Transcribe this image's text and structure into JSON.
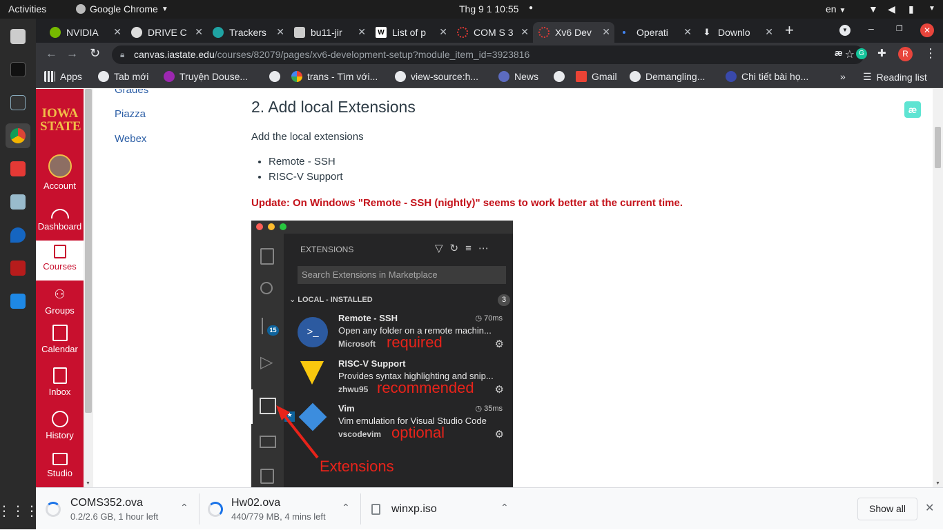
{
  "topbar": {
    "activities": "Activities",
    "app": "Google Chrome",
    "clock": "Thg 9 1  10:55",
    "lang": "en"
  },
  "tabs": [
    {
      "title": "NVIDIA",
      "fav_color": "#76b900"
    },
    {
      "title": "DRIVE C",
      "fav_color": "#dddddd"
    },
    {
      "title": "Trackers",
      "fav_color": "#1fa3a3"
    },
    {
      "title": "bu11-jir",
      "fav_color": "#cccccc"
    },
    {
      "title": "List of p",
      "fav_color": "#ffffff"
    },
    {
      "title": "COM S 3",
      "fav_color": "#e53935"
    },
    {
      "title": "Xv6 Dev",
      "fav_color": "#e53935"
    },
    {
      "title": "Operati",
      "fav_color": "#4285f4"
    },
    {
      "title": "Downlo",
      "fav_color": "#e8eaed"
    }
  ],
  "address": {
    "host": "canvas.iastate.edu",
    "path": "/courses/82079/pages/xv6-development-setup?module_item_id=3923816",
    "avatar_letter": "R"
  },
  "bookmarks": [
    {
      "label": "Apps"
    },
    {
      "label": "Tab mới"
    },
    {
      "label": "Truyện Douse..."
    },
    {
      "label": ""
    },
    {
      "label": "trans - Tìm với..."
    },
    {
      "label": "view-source:h..."
    },
    {
      "label": "News"
    },
    {
      "label": ""
    },
    {
      "label": "Gmail"
    },
    {
      "label": "Demangling..."
    },
    {
      "label": "Chi tiết bài họ..."
    },
    {
      "label": "»"
    },
    {
      "label": "Reading list"
    }
  ],
  "canvas_nav": {
    "logo_line1": "IOWA",
    "logo_line2": "STATE",
    "items": [
      {
        "label": "Account"
      },
      {
        "label": "Dashboard"
      },
      {
        "label": "Courses"
      },
      {
        "label": "Groups"
      },
      {
        "label": "Calendar"
      },
      {
        "label": "Inbox"
      },
      {
        "label": "History"
      },
      {
        "label": "Studio"
      }
    ]
  },
  "course_nav": {
    "items": [
      {
        "label": "Grades"
      },
      {
        "label": "Piazza"
      },
      {
        "label": "Webex"
      }
    ]
  },
  "content": {
    "heading": "2. Add local Extensions",
    "intro": "Add the local extensions",
    "bullets": [
      "Remote - SSH",
      "RISC-V Support"
    ],
    "update": "Update: On Windows \"Remote - SSH (nightly)\" seems to work better at the current time."
  },
  "vscode": {
    "panel_title": "EXTENSIONS",
    "search_placeholder": "Search Extensions in Marketplace",
    "section": "LOCAL - INSTALLED",
    "section_count": "3",
    "scm_badge": "15",
    "extensions": [
      {
        "name": "Remote - SSH",
        "time": "70ms",
        "desc": "Open any folder on a remote machin...",
        "publisher": "Microsoft",
        "note": "required"
      },
      {
        "name": "RISC-V Support",
        "time": "",
        "desc": "Provides syntax highlighting and snip...",
        "publisher": "zhwu95",
        "note": "recommended"
      },
      {
        "name": "Vim",
        "time": "35ms",
        "desc": "Vim emulation for Visual Studio Code",
        "publisher": "vscodevim",
        "note": "optional"
      }
    ],
    "arrow_label": "Extensions"
  },
  "downloads": {
    "items": [
      {
        "name": "COMS352.ova",
        "status": "0.2/2.6 GB, 1 hour left"
      },
      {
        "name": "Hw02.ova",
        "status": "440/779 MB, 4 mins left"
      },
      {
        "name": "winxp.iso",
        "status": ""
      }
    ],
    "show_all": "Show all"
  }
}
